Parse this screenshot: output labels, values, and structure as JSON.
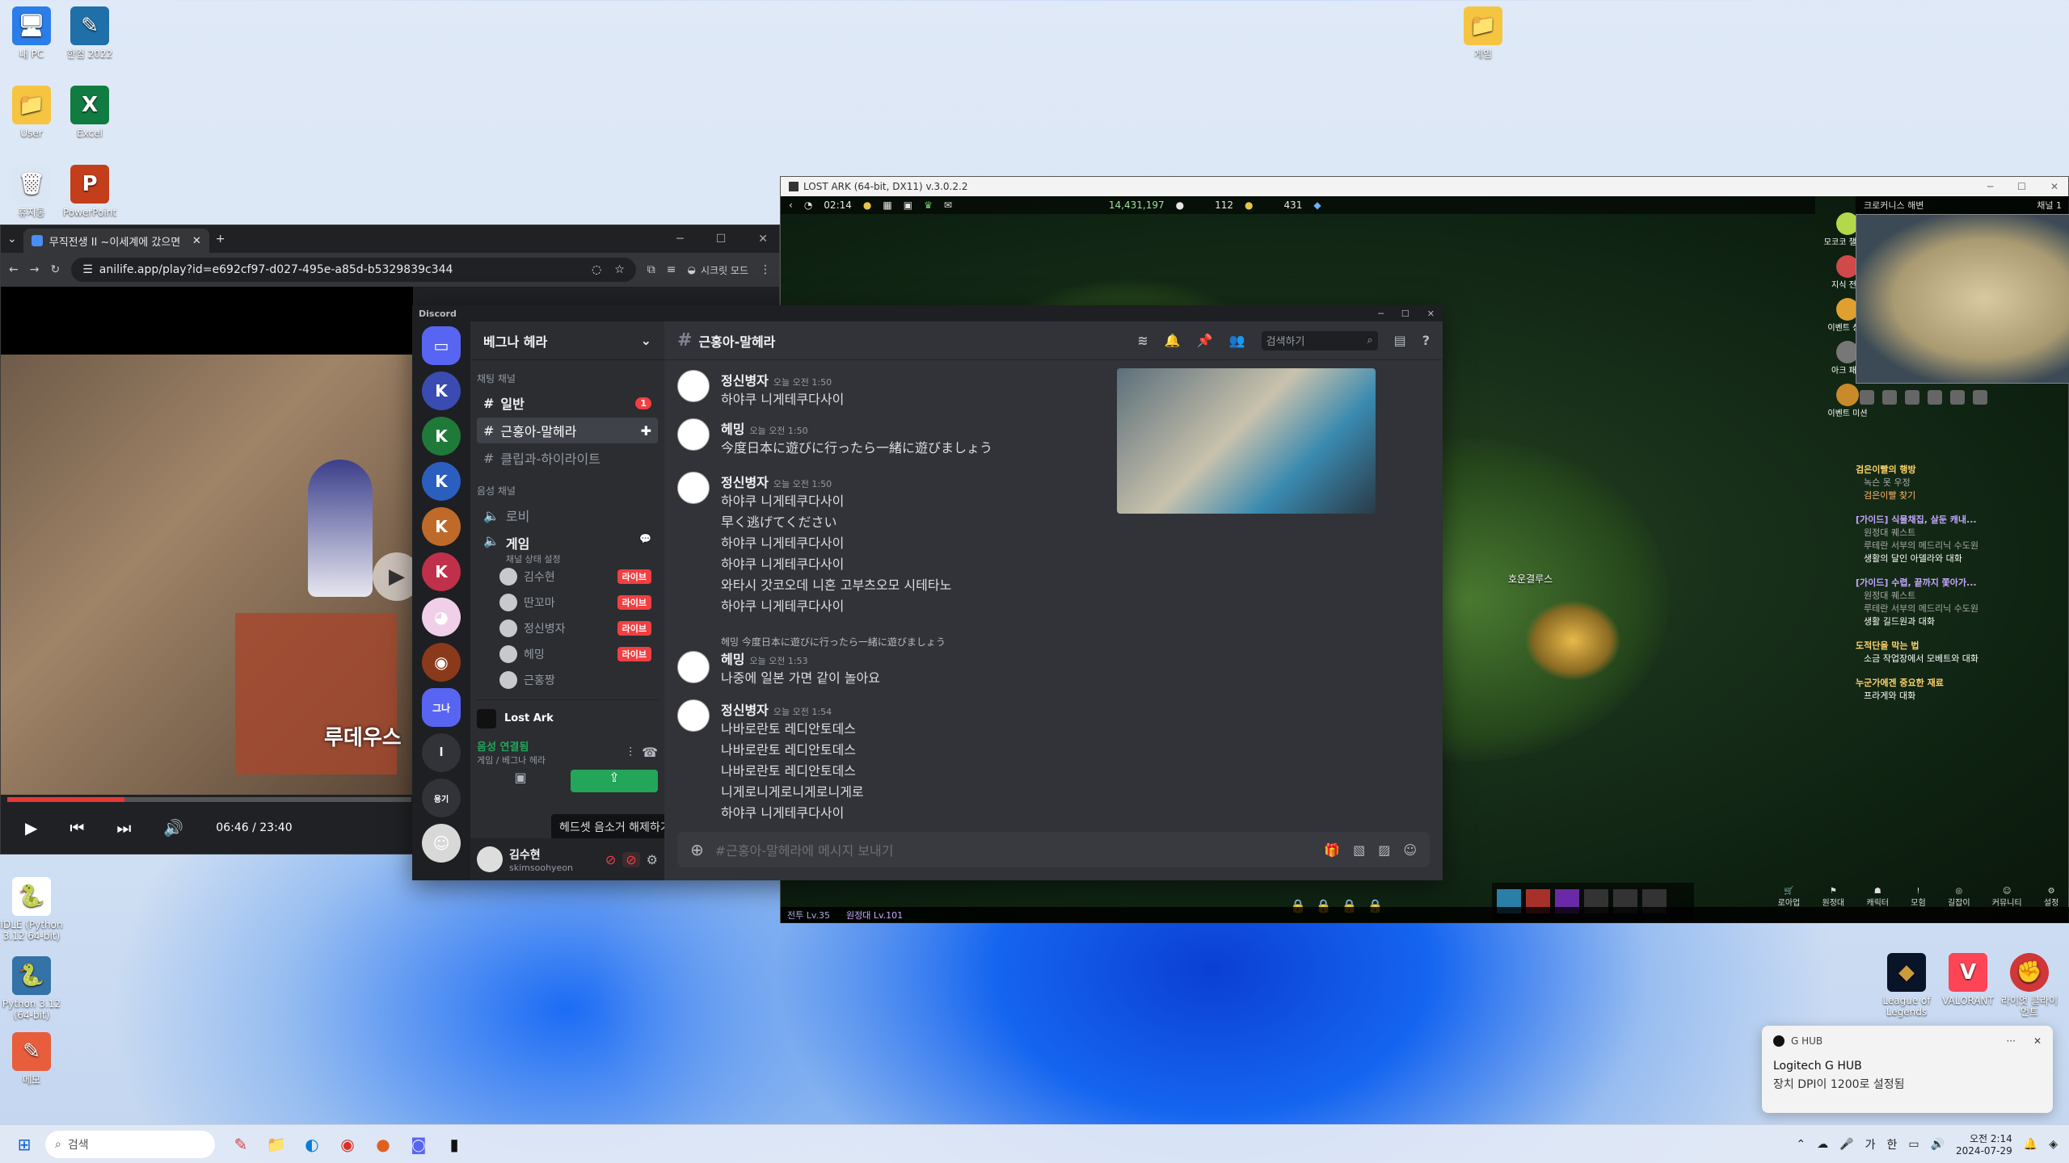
{
  "desktop": {
    "icons_left": [
      {
        "label": "내 PC",
        "glyph": "🖥"
      },
      {
        "label": "한컴 2022",
        "glyph": "✎"
      },
      {
        "label": "User",
        "glyph": "📁"
      },
      {
        "label": "Excel",
        "glyph": "X"
      },
      {
        "label": "휴지통",
        "glyph": "🗑"
      },
      {
        "label": "PowerPoint",
        "glyph": "P"
      }
    ],
    "icon_top_right": {
      "label": "게임",
      "glyph": "📁"
    },
    "icons_bottom_left": [
      {
        "label": "IDLE (Python 3.12 64-bit)",
        "glyph": "🐍"
      },
      {
        "label": "Python 3.12 (64-bit)",
        "glyph": "🐍"
      },
      {
        "label": "메모",
        "glyph": "✎"
      }
    ],
    "icons_bottom_right": [
      {
        "label": "League of Legends",
        "glyph": "◆"
      },
      {
        "label": "VALORANT",
        "glyph": "V"
      },
      {
        "label": "라이엇 클라이언트",
        "glyph": "✊"
      }
    ]
  },
  "browser": {
    "tab_title": "무직전생 II ~이세계에 갔으면",
    "url": "anilife.app/play?id=e692cf97-d027-495e-a85d-b5329839c344",
    "secret_mode": "시크릿 모드",
    "subtitle": "루데우스",
    "time": "06:46 / 23:40",
    "progress": 0.29
  },
  "discord": {
    "app_name": "Discord",
    "server_name": "베그나 헤라",
    "text_category": "채팅 채널",
    "text_channels": [
      {
        "name": "일반",
        "badge": "1"
      },
      {
        "name": "근홍아-말헤라",
        "badge": ""
      },
      {
        "name": "클립과-하이라이트",
        "badge": ""
      }
    ],
    "voice_category": "음성 채널",
    "voice_channels": [
      {
        "name": "로비"
      },
      {
        "name": "게임",
        "status": "채널 상태 설정"
      }
    ],
    "voice_users": [
      {
        "name": "김수현",
        "live": "라이브"
      },
      {
        "name": "딴꼬마",
        "live": "라이브"
      },
      {
        "name": "정신병자",
        "live": "라이브"
      },
      {
        "name": "헤밍",
        "live": "라이브"
      },
      {
        "name": "근홍짱",
        "live": ""
      }
    ],
    "activity": "Lost Ark",
    "voice_connected": "음성 연결됨",
    "voice_location": "게임 / 베그나 헤라",
    "tooltip": "헤드셋 음소거 해제하기",
    "user_name": "김수현",
    "user_tag": "skimsoohyeon",
    "channel_title": "근홍아-말헤라",
    "search_placeholder": "검색하기",
    "composer_placeholder": "#근홍아-말헤라에 메시지 보내기",
    "messages": [
      {
        "who": "정신병자",
        "time": "오늘 오전 1:50",
        "lines": [
          "하야쿠 니게테쿠다사이"
        ]
      },
      {
        "who": "헤밍",
        "time": "오늘 오전 1:50",
        "lines": [
          "今度日本に遊びに行ったら一緒に遊びましょう"
        ]
      },
      {
        "who": "정신병자",
        "time": "오늘 오전 1:50",
        "lines": [
          "하야쿠 니게테쿠다사이",
          "早く逃げてください",
          "하야쿠 니게테쿠다사이",
          "하야쿠 니게테쿠다사이",
          "와타시 갓코오데 니혼 고부츠오모 시테타노",
          "하야쿠 니게테쿠다사이"
        ]
      },
      {
        "who": "헤밍",
        "time": "오늘 오전 1:53",
        "reply": "헤밍 今度日本に遊びに行ったら一緒に遊びましょう",
        "lines": [
          "나중에 일본 가면 같이 놀아요"
        ]
      },
      {
        "who": "정신병자",
        "time": "오늘 오전 1:54",
        "lines": [
          "나바로란토 레디안토데스",
          "나바로란토 레디안토데스",
          "나바로란토 레디안토데스",
          "니게로니게로니게로니게로",
          "하야쿠 니게테쿠다사이"
        ]
      }
    ]
  },
  "lostark": {
    "title": "LOST ARK (64-bit, DX11) v.3.0.2.2",
    "clock": "02:14",
    "silver": "14,431,197",
    "gold": "112",
    "crystal": "431",
    "zone": "크로커니스 해변",
    "channel": "채널 1",
    "side_menu": [
      "모코코 챌린지",
      "지식 전수",
      "이벤트 상점",
      "아크 패스",
      "이벤트 미션"
    ],
    "quests": [
      {
        "title": "검은이빨의 행방",
        "sub": [
          "녹슨 못 우정",
          "검은이빨 찾기"
        ]
      },
      {
        "title": "[가이드] 식물채집, 살둔 캐내...",
        "sub": [
          "원정대 퀘스트",
          "루테란 서부의 메드리닉 수도원",
          "생활의 달인 아델라와 대화"
        ]
      },
      {
        "title": "[가이드] 수렵, 끝까지 쫓아가...",
        "sub": [
          "원정대 퀘스트",
          "루테란 서부의 메드리닉 수도원",
          "생활 길드원과 대화"
        ]
      },
      {
        "title": "도적단을 막는 법",
        "sub": [
          "소금 작업장에서 모베트와 대화"
        ]
      },
      {
        "title": "누군가에겐 중요한 재료",
        "sub": [
          "프라게와 대화"
        ]
      }
    ],
    "npc_label": "호운결루스",
    "status_left": "전투 Lv.35",
    "status_right": "원정대 Lv.101",
    "bottom_menu": [
      "로아업",
      "원정대",
      "캐릭터",
      "모험",
      "길잡이",
      "커뮤니티",
      "설정"
    ]
  },
  "toast": {
    "app": "G HUB",
    "title": "Logitech G HUB",
    "body": "장치 DPI이 1200로 설정됨"
  },
  "taskbar": {
    "search_placeholder": "검색",
    "tray": [
      "가",
      "한"
    ],
    "time": "오전 2:14",
    "date": "2024-07-29"
  },
  "colors": {
    "discord_bg": "#313338",
    "discord_sidebar": "#2b2d31",
    "discord_red": "#f23f42",
    "discord_green": "#23a55a",
    "windows_blue": "#1565f0"
  }
}
